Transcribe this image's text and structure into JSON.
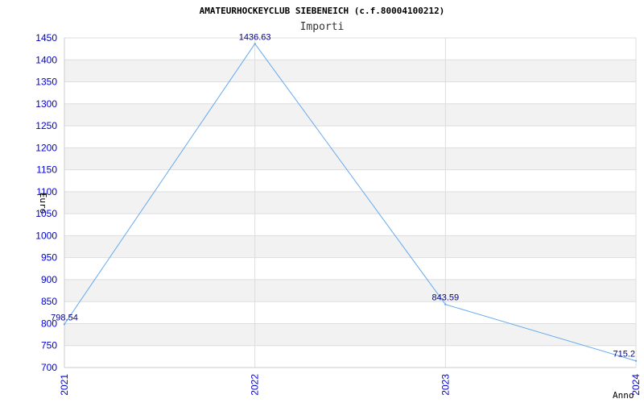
{
  "chart_data": {
    "type": "line",
    "title": "AMATEURHOCKEYCLUB SIEBENEICH (c.f.80004100212)",
    "subtitle": "Importi",
    "xlabel": "Anno",
    "ylabel": "Euro",
    "x": [
      "2021",
      "2022",
      "2023",
      "2024"
    ],
    "series": [
      {
        "values": [
          798.54,
          1436.63,
          843.59,
          715.2
        ],
        "labels": [
          "798.54",
          "1436.63",
          "843.59",
          "715.2"
        ]
      }
    ],
    "ylim": [
      700,
      1450
    ],
    "yticks": [
      700,
      750,
      800,
      850,
      900,
      950,
      1000,
      1050,
      1100,
      1150,
      1200,
      1250,
      1300,
      1350,
      1400,
      1450
    ],
    "grid": true,
    "colors": {
      "line": "#66aaee",
      "band": "#f2f2f2",
      "tick": "#0000cc",
      "data_label": "#000080"
    }
  }
}
